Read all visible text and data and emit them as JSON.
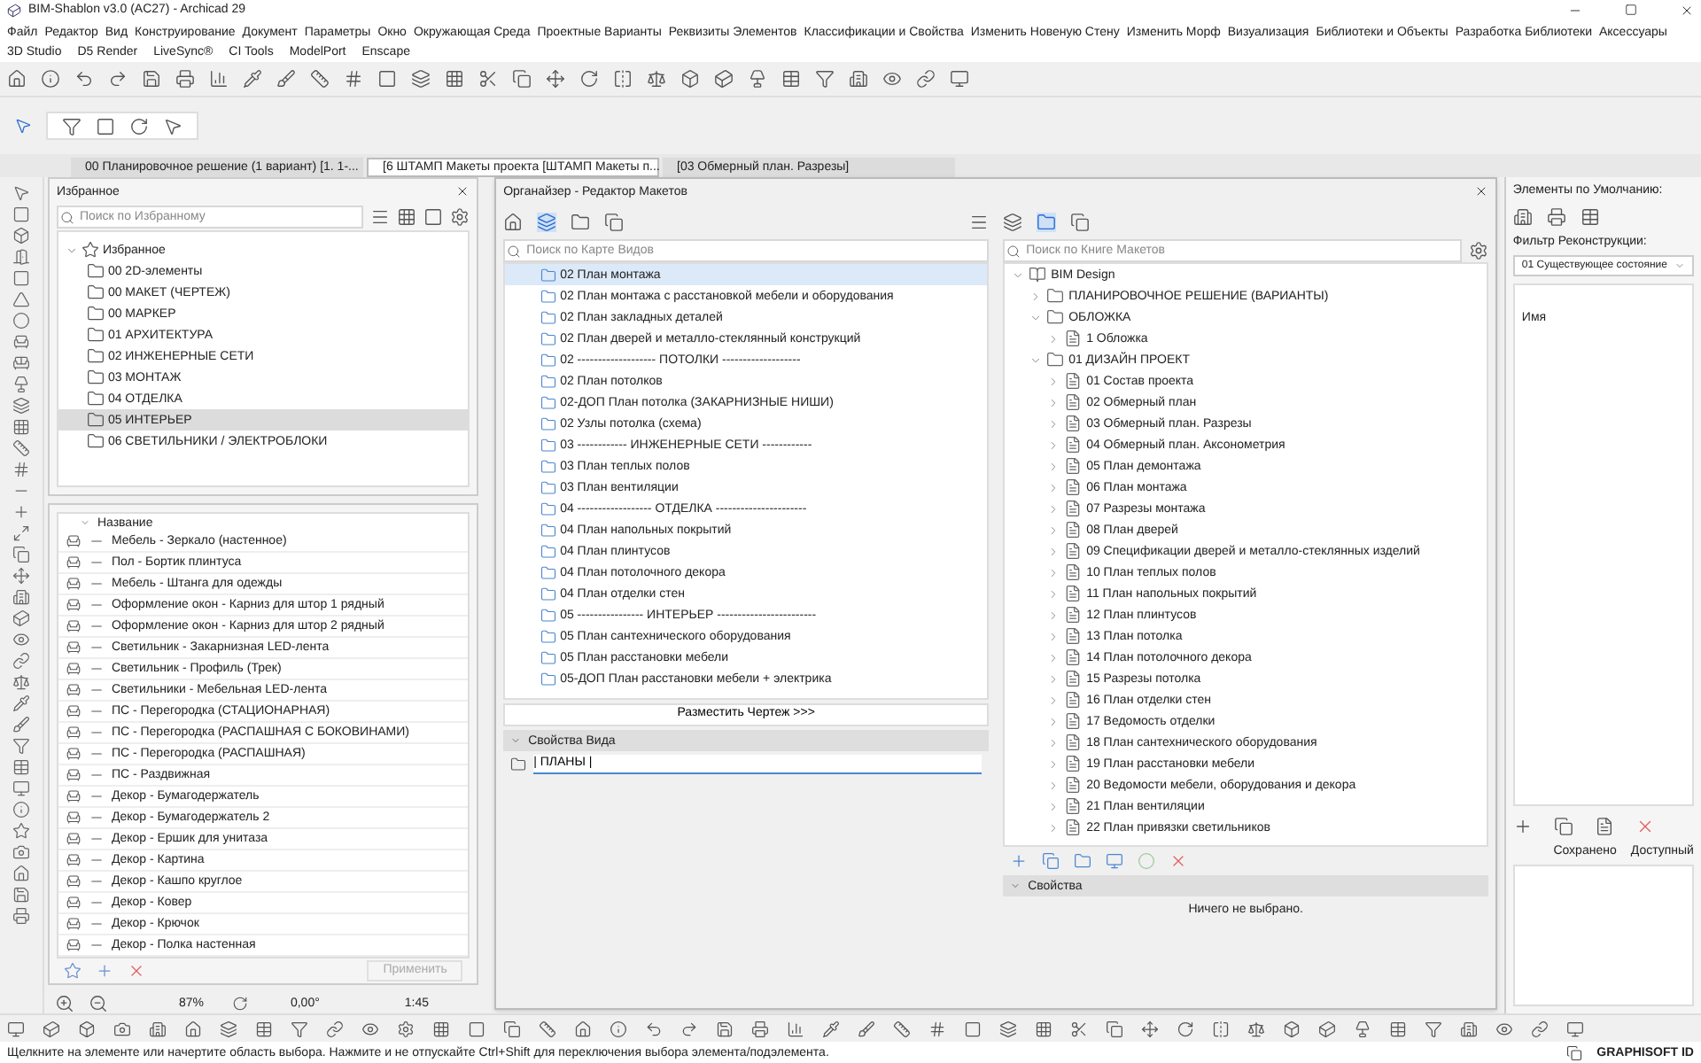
{
  "window": {
    "title": "BIM-Shablon v3.0 (AC27) - Archicad 29"
  },
  "menu_bar": {
    "items": [
      "Файл",
      "Редактор",
      "Вид",
      "Конструирование",
      "Документ",
      "Параметры",
      "Окно",
      "Окружающая Среда",
      "Проектные Варианты",
      "Реквизиты Элементов",
      "Классификации и Свойства",
      "Изменить Новеную Стену",
      "Изменить Морф",
      "Визуализация",
      "Библиотеки и Объекты",
      "Разработка Библиотеки",
      "Аксессуары"
    ]
  },
  "plugin_menu": {
    "items": [
      "3D Studio",
      "D5 Render",
      "LiveSync®",
      "CI Tools",
      "ModelPort",
      "Enscape"
    ]
  },
  "tabs": [
    {
      "label": "00 Планировочное решение (1 вариант) [1. 1-...",
      "selected": false
    },
    {
      "label": "[6 ШТАМП Макеты проекта [ШТАМП Макеты п...",
      "selected": true
    },
    {
      "label": "[03 Обмерный план. Разрезы]",
      "selected": false
    }
  ],
  "favorites": {
    "title": "Избранное",
    "search": {
      "placeholder": "Поиск по Избранному"
    },
    "root": {
      "label": "Избранное",
      "expanded": true,
      "children": [
        {
          "label": "00 2D-элементы",
          "selected": false
        },
        {
          "label": "00 МАКЕТ (ЧЕРТЕЖ)",
          "selected": false
        },
        {
          "label": "00 МАРКЕР",
          "selected": false
        },
        {
          "label": "01 АРХИТЕКТУРА",
          "selected": false
        },
        {
          "label": "02 ИНЖЕНЕРНЫЕ СЕТИ",
          "selected": false
        },
        {
          "label": "03 МОНТАЖ",
          "selected": false
        },
        {
          "label": "04 ОТДЕЛКА",
          "selected": false
        },
        {
          "label": "05 ИНТЕРЬЕР",
          "selected": true
        },
        {
          "label": "06 СВЕТИЛЬНИКИ / ЭЛЕКТРОБЛОКИ",
          "selected": false
        }
      ]
    }
  },
  "library": {
    "column": "Название",
    "items": [
      "Мебель - Зеркало (настенное)",
      "Пол - Бортик плинтуса",
      "Мебель - Штанга для одежды",
      "Оформление окон - Карниз для штор 1 рядный",
      "Оформление окон - Карниз для штор 2 рядный",
      "Светильник - Закарнизная LED-лента",
      "Светильник - Профиль (Трек)",
      "Светильники - Мебельная LED-лента",
      "ПС - Перегородка (СТАЦИОНАРНАЯ)",
      "ПС - Перегородка (РАСПАШНАЯ С БОКОВИНАМИ)",
      "ПС - Перегородка (РАСПАШНАЯ)",
      "ПС - Раздвижная",
      "Декор - Бумагодержатель",
      "Декор - Бумагодержатель 2",
      "Декор - Ершик для унитаза",
      "Декор - Картина",
      "Декор - Кашпо круглое",
      "Декор - Ковер",
      "Декор - Крючок",
      "Декор - Полка настенная"
    ],
    "apply_button": {
      "label": "Применить",
      "disabled": true
    }
  },
  "navigator": {
    "zoom": "87%",
    "angle": "0,00°",
    "scale": "1:45"
  },
  "organizer": {
    "title": "Органайзер - Редактор Макетов",
    "view_map": {
      "search": {
        "placeholder": "Поиск по Карте Видов"
      },
      "items": [
        {
          "label": "02 План монтажа",
          "selected": true
        },
        {
          "label": "02 План монтажа с расстановкой мебели и оборудования",
          "selected": false
        },
        {
          "label": "02 План закладных деталей",
          "selected": false
        },
        {
          "label": "02 План дверей и металло-стеклянный конструкций",
          "selected": false
        },
        {
          "label": "02 ------------------- ПОТОЛКИ -------------------",
          "selected": false
        },
        {
          "label": "02 План потолков",
          "selected": false
        },
        {
          "label": "02-ДОП План потолка (ЗАКАРНИЗНЫЕ НИШИ)",
          "selected": false
        },
        {
          "label": "02 Узлы потолка (схема)",
          "selected": false
        },
        {
          "label": "03 ------------ ИНЖЕНЕРНЫЕ СЕТИ ------------",
          "selected": false
        },
        {
          "label": "03 План теплых полов",
          "selected": false
        },
        {
          "label": "03 План вентиляции",
          "selected": false
        },
        {
          "label": "04 ------------------ ОТДЕЛКА ----------------------",
          "selected": false
        },
        {
          "label": "04 План напольных покрытий",
          "selected": false
        },
        {
          "label": "04 План плинтусов",
          "selected": false
        },
        {
          "label": "04 План потолочного декора",
          "selected": false
        },
        {
          "label": "04 План отделки стен",
          "selected": false
        },
        {
          "label": "05 ---------------- ИНТЕРЬЕР ------------------------",
          "selected": false
        },
        {
          "label": "05 План сантехнического оборудования",
          "selected": false
        },
        {
          "label": "05 План расстановки мебели",
          "selected": false
        },
        {
          "label": "05-ДОП План расстановки мебели + электрика",
          "selected": false
        }
      ],
      "place_button": "Разместить Чертеж >>>",
      "view_properties": {
        "header": "Свойства Вида",
        "value": "| ПЛАНЫ |"
      }
    },
    "layout_book": {
      "search": {
        "placeholder": "Поиск по Книге Макетов"
      },
      "tree": [
        {
          "kind": "book",
          "label": "BIM Design",
          "expanded": true,
          "children": [
            {
              "kind": "folder",
              "label": "ПЛАНИРОВОЧНОЕ РЕШЕНИЕ (ВАРИАНТЫ)",
              "expanded": false
            },
            {
              "kind": "folder",
              "label": "ОБЛОЖКА",
              "expanded": true,
              "children": [
                {
                  "kind": "layout",
                  "label": "1 Обложка",
                  "expanded": false
                }
              ]
            },
            {
              "kind": "folder",
              "label": "01 ДИЗАЙН ПРОЕКТ",
              "expanded": true,
              "children": [
                {
                  "kind": "layout",
                  "label": "01 Состав проекта",
                  "expanded": false
                },
                {
                  "kind": "layout",
                  "label": "02 Обмерный план",
                  "expanded": false
                },
                {
                  "kind": "layout",
                  "label": "03 Обмерный план. Разрезы",
                  "expanded": false
                },
                {
                  "kind": "layout",
                  "label": "04 Обмерный план. Аксонометрия",
                  "expanded": false
                },
                {
                  "kind": "layout",
                  "label": "05 План демонтажа",
                  "expanded": false
                },
                {
                  "kind": "layout",
                  "label": "06 План монтажа",
                  "expanded": false
                },
                {
                  "kind": "layout",
                  "label": "07 Разрезы монтажа",
                  "expanded": false
                },
                {
                  "kind": "layout",
                  "label": "08 План дверей",
                  "expanded": false
                },
                {
                  "kind": "layout",
                  "label": "09 Спецификации дверей и металло-стеклянных изделий",
                  "expanded": false
                },
                {
                  "kind": "layout",
                  "label": "10 План теплых полов",
                  "expanded": false
                },
                {
                  "kind": "layout",
                  "label": "11 План напольных покрытий",
                  "expanded": false
                },
                {
                  "kind": "layout",
                  "label": "12 План плинтусов",
                  "expanded": false
                },
                {
                  "kind": "layout",
                  "label": "13 План потолка",
                  "expanded": false
                },
                {
                  "kind": "layout",
                  "label": "14 План потолочного декора",
                  "expanded": false
                },
                {
                  "kind": "layout",
                  "label": "15 Разрезы потолка",
                  "expanded": false
                },
                {
                  "kind": "layout",
                  "label": "16 План отделки стен",
                  "expanded": false
                },
                {
                  "kind": "layout",
                  "label": "17 Ведомость отделки",
                  "expanded": false
                },
                {
                  "kind": "layout",
                  "label": "18 План сантехнического оборудования",
                  "expanded": false
                },
                {
                  "kind": "layout",
                  "label": "19 План расстановки мебели",
                  "expanded": false
                },
                {
                  "kind": "layout",
                  "label": "20 Ведомости мебели, оборудования и декора",
                  "expanded": false
                },
                {
                  "kind": "layout",
                  "label": "21 План вентиляции",
                  "expanded": false
                },
                {
                  "kind": "layout",
                  "label": "22 План привязки светильников",
                  "expanded": false
                }
              ]
            }
          ]
        }
      ],
      "properties": {
        "header": "Свойства",
        "message": "Ничего не выбрано."
      }
    }
  },
  "defaults_panel": {
    "title": "Элементы по Умолчанию:",
    "filter_label": "Фильтр Реконструкции:",
    "filter_value": "01 Существующее состояние",
    "column": "Имя",
    "tabs": [
      "Сохранено",
      "Доступный"
    ]
  },
  "status_bar": {
    "message": "Щелкните на элементе или начертите область выбора. Нажмите и не отпускайте Ctrl+Shift для переключения выбора элемента/подэлемента.",
    "account": "GRAPHISOFT ID"
  }
}
